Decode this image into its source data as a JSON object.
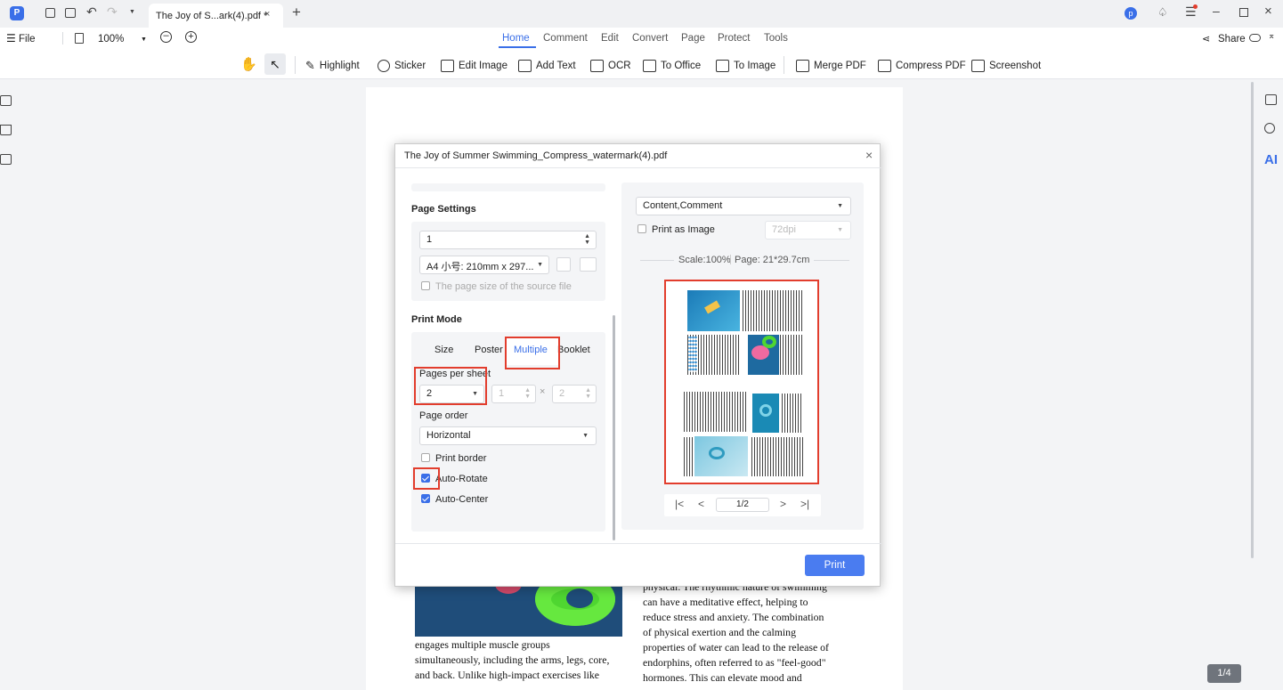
{
  "titlebar": {
    "tab_title": "The Joy of S...ark(4).pdf *",
    "avatar_letter": "p"
  },
  "menubar": {
    "file_label": "File",
    "zoom": "100%",
    "share_label": "Share"
  },
  "nav_tabs": [
    "Home",
    "Comment",
    "Edit",
    "Convert",
    "Page",
    "Protect",
    "Tools"
  ],
  "toolbar": {
    "highlight": "Highlight",
    "sticker": "Sticker",
    "edit_image": "Edit Image",
    "add_text": "Add Text",
    "ocr": "OCR",
    "to_office": "To Office",
    "to_image": "To Image",
    "merge_pdf": "Merge PDF",
    "compress_pdf": "Compress PDF",
    "screenshot": "Screenshot"
  },
  "right_sidebar": {
    "ai_label": "AI"
  },
  "page_indicator": "1/4",
  "document": {
    "left_col": [
      "engages multiple muscle groups",
      "simultaneously, including the arms, legs, core,",
      "and back. Unlike high-impact exercises like"
    ],
    "right_col": [
      "physical. The rhythmic nature of swimming",
      "can have a meditative effect, helping to",
      "reduce stress and anxiety. The combination",
      "of physical exertion and the calming",
      "properties of water can lead to the release of",
      "endorphins, often referred to as \"feel-good\"",
      "hormones. This can elevate mood and"
    ]
  },
  "dialog": {
    "title": "The Joy of Summer Swimming_Compress_watermark(4).pdf",
    "page_settings": {
      "heading": "Page Settings",
      "copies": "1",
      "paper_size": "A4 小号: 210mm x 297...",
      "source_size_label": "The page size of the source file"
    },
    "print_mode": {
      "heading": "Print Mode",
      "tabs": [
        "Size",
        "Poster",
        "Multiple",
        "Booklet"
      ],
      "active_tab": "Multiple",
      "pages_per_sheet_label": "Pages per sheet",
      "pages_per_sheet": "2",
      "cols": "1",
      "rows": "2",
      "page_order_label": "Page order",
      "page_order": "Horizontal",
      "print_border_label": "Print border",
      "print_border": false,
      "auto_rotate_label": "Auto-Rotate",
      "auto_rotate": true,
      "auto_center_label": "Auto-Center",
      "auto_center": true
    },
    "preview": {
      "content_select": "Content,Comment",
      "print_as_image_label": "Print as Image",
      "dpi": "72dpi",
      "scale_text": "Scale:100%",
      "page_size_text": "Page: 21*29.7cm",
      "page_nav": "1/2"
    },
    "print_button": "Print"
  },
  "colors": {
    "accent": "#3a6fe8",
    "highlight_box": "#e23d2d",
    "print_button": "#4a7cf0"
  }
}
